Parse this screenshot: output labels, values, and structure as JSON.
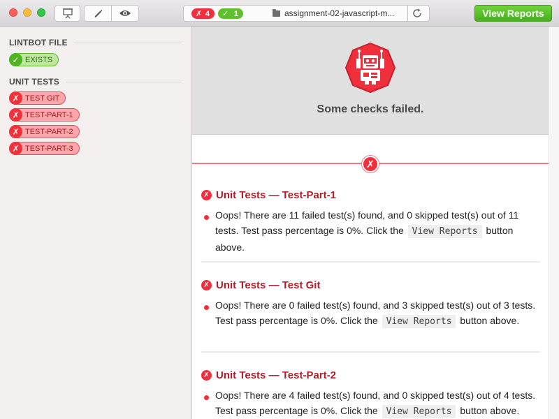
{
  "toolbar": {
    "fail_count": "4",
    "pass_count": "1",
    "fail_mark": "✗",
    "pass_mark": "✓",
    "path": "assignment-02-javascript-m...",
    "view_reports_label": "View Reports"
  },
  "sidebar": {
    "sections": [
      {
        "title": "LINTBOT FILE",
        "items": [
          {
            "label": "EXISTS",
            "status": "pass"
          }
        ]
      },
      {
        "title": "UNIT TESTS",
        "items": [
          {
            "label": "TEST GIT",
            "status": "fail"
          },
          {
            "label": "TEST-PART-1",
            "status": "fail"
          },
          {
            "label": "TEST-PART-2",
            "status": "fail"
          },
          {
            "label": "TEST-PART-3",
            "status": "fail"
          }
        ]
      }
    ]
  },
  "main": {
    "status_message": "Some checks failed.",
    "results": [
      {
        "title": "Unit Tests — Test-Part-1",
        "message_pre": "Oops! There are 11 failed test(s) found, and 0 skipped test(s) out of 11 tests. Test pass percentage is 0%. Click the",
        "button_ref": "View Reports",
        "message_post": "button above."
      },
      {
        "title": "Unit Tests — Test Git",
        "message_pre": "Oops! There are 0 failed test(s) found, and 3 skipped test(s) out of 3 tests. Test pass percentage is 0%. Click the",
        "button_ref": "View Reports",
        "message_post": "button above."
      },
      {
        "title": "Unit Tests — Test-Part-2",
        "message_pre": "Oops! There are 4 failed test(s) found, and 0 skipped test(s) out of 4 tests. Test pass percentage is 0%. Click the",
        "button_ref": "View Reports",
        "message_post": "button above."
      }
    ]
  },
  "colors": {
    "fail": "#ef2f3c",
    "pass": "#4db51f",
    "accent_green": "#5cc42c",
    "title_red": "#b01e2a"
  },
  "icons": {
    "presentation": "presentation-icon",
    "edit": "pencil-icon",
    "view": "eye-icon",
    "folder": "folder-icon",
    "reload": "reload-icon",
    "robot": "robot-icon"
  }
}
